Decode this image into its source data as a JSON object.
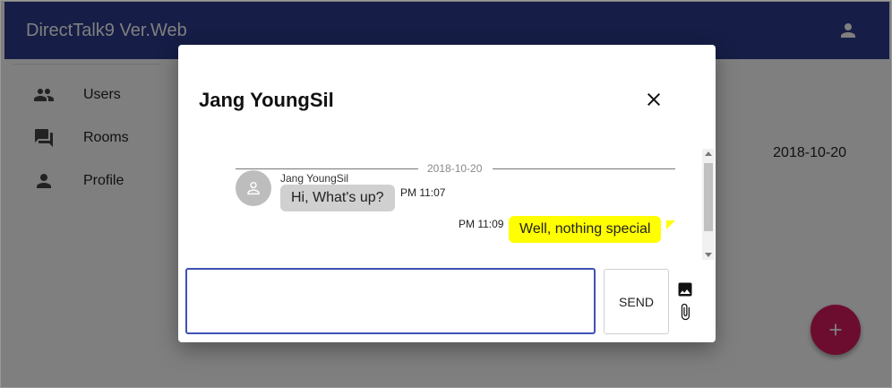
{
  "app": {
    "title": "DirectTalk9 Ver.Web",
    "account_icon": "account-icon",
    "appbar_color": "#2c3a8c",
    "fab_color": "#d81b60"
  },
  "sidebar": {
    "items": [
      {
        "label": "Users",
        "icon": "people-icon"
      },
      {
        "label": "Rooms",
        "icon": "forum-icon"
      },
      {
        "label": "Profile",
        "icon": "person-icon"
      }
    ]
  },
  "room_list": {
    "date": "2018-10-20"
  },
  "fab": {
    "icon": "plus-icon"
  },
  "dialog": {
    "title": "Jang YoungSil",
    "close_icon": "close-icon",
    "date_divider": "2018-10-20",
    "messages": [
      {
        "direction": "in",
        "sender": "Jang YoungSil",
        "text": "Hi, What's up?",
        "time": "PM 11:07",
        "bubble_color": "#d0d0d0"
      },
      {
        "direction": "out",
        "text": "Well, nothing special",
        "time": "PM 11:09",
        "bubble_color": "#ffff00"
      }
    ],
    "composer": {
      "value": "",
      "placeholder": ""
    },
    "send_label": "SEND",
    "image_icon": "image-icon",
    "attach_icon": "paperclip-icon"
  }
}
